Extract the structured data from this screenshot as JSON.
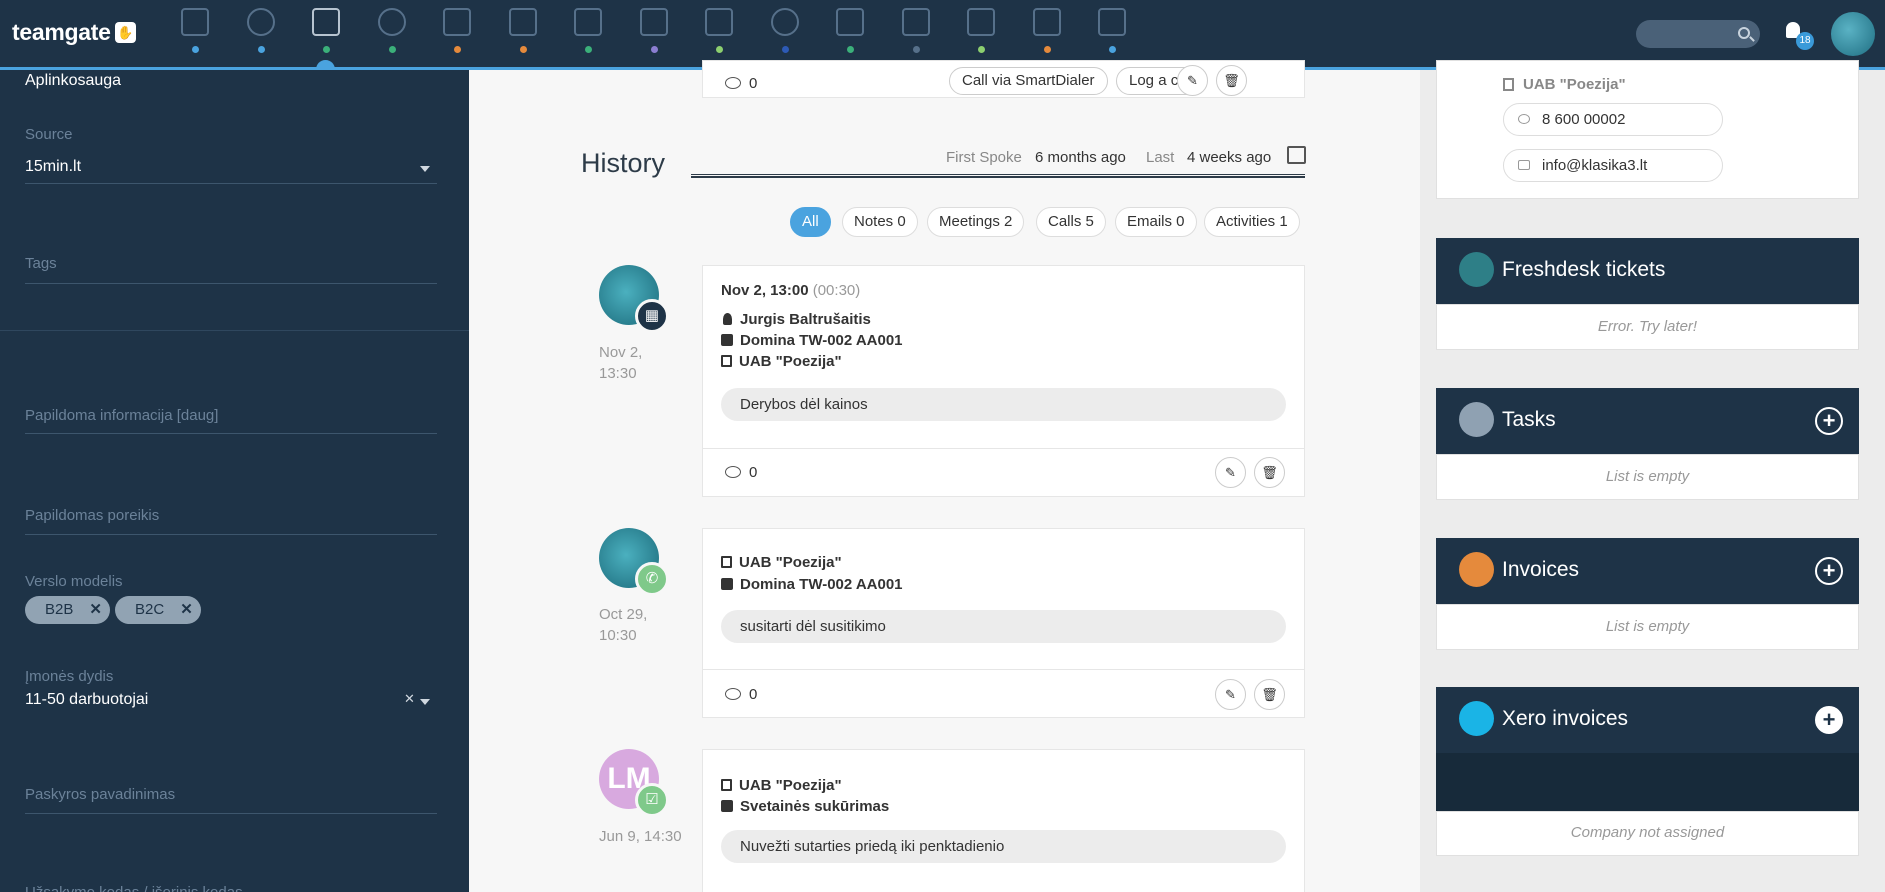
{
  "topbar": {
    "logo": "teamgate",
    "logo_icon": "hand-icon",
    "nav_icons": [
      {
        "name": "dashboard-icon",
        "dot": "#4aa3df"
      },
      {
        "name": "target-icon",
        "dot": "#4aa3df"
      },
      {
        "name": "companies-icon",
        "dot": "#3bb07a"
      },
      {
        "name": "people-icon",
        "dot": "#3bb07a"
      },
      {
        "name": "deals-icon",
        "dot": "#e58a3c"
      },
      {
        "name": "calendar-icon",
        "dot": "#e58a3c"
      },
      {
        "name": "chat-icon",
        "dot": "#3bb07a"
      },
      {
        "name": "download-icon",
        "dot": "#8b7ed1"
      },
      {
        "name": "attachment-icon",
        "dot": "#8ccf6f"
      },
      {
        "name": "pie-chart-icon",
        "dot": "#2d5ab5"
      },
      {
        "name": "messages-icon",
        "dot": "#3bb07a"
      },
      {
        "name": "edit-icon",
        "dot": "#56708a"
      },
      {
        "name": "clip-icon",
        "dot": "#8ccf6f"
      },
      {
        "name": "invoices-icon",
        "dot": "#e58a3c"
      },
      {
        "name": "folder-icon",
        "dot": "#4aa3df"
      }
    ],
    "notifications_count": "18"
  },
  "sidebar": {
    "industry_value": "Aplinkosauga",
    "source_label": "Source",
    "source_value": "15min.lt",
    "tags_label": "Tags",
    "extra_info_label": "Papildoma informacija [daug]",
    "extra_need_label": "Papildomas poreikis",
    "business_model_label": "Verslo modelis",
    "business_model_chips": [
      "B2B",
      "B2C"
    ],
    "company_size_label": "Įmonės dydis",
    "company_size_value": "11-50 darbuotojai",
    "account_name_label": "Paskyros pavadinimas",
    "cutoff_label": "Užsakymo kodas / išorinis kodas"
  },
  "main": {
    "top_card": {
      "comments": "0",
      "call_smartdialer": "Call via SmartDialer",
      "log_call": "Log a call"
    },
    "history": {
      "title": "History",
      "first_spoke_label": "First Spoke",
      "first_spoke_value": "6 months ago",
      "last_label": "Last",
      "last_value": "4 weeks ago",
      "tabs": [
        "All",
        "Notes 0",
        "Meetings 2",
        "Calls 5",
        "Emails 0",
        "Activities 1"
      ]
    },
    "events": [
      {
        "date_line1": "Nov 2,",
        "date_line2": "13:30",
        "header": "Nov 2, 13:00",
        "duration": "(00:30)",
        "person": "Jurgis Baltrušaitis",
        "deal": "Domina TW-002 AA001",
        "company": "UAB \"Poezija\"",
        "note": "Derybos dėl kainos",
        "comments": "0",
        "type": "meeting",
        "type_color": "#1e3347"
      },
      {
        "date_line1": "Oct 29,",
        "date_line2": "10:30",
        "company": "UAB \"Poezija\"",
        "deal": "Domina TW-002 AA001",
        "note": "susitarti dėl susitikimo",
        "comments": "0",
        "type": "call",
        "type_color": "#7fc98a"
      },
      {
        "date_line1": "Jun 9, 14:30",
        "avatar_initials": "LM",
        "company": "UAB \"Poezija\"",
        "deal": "Svetainės sukūrimas",
        "note": "Nuvežti sutarties priedą iki penktadienio",
        "type": "task",
        "type_color": "#7fc98a"
      }
    ]
  },
  "right": {
    "contact": {
      "company": "UAB \"Poezija\"",
      "phone": "8 600 00002",
      "email": "info@klasika3.lt"
    },
    "freshdesk": {
      "title": "Freshdesk tickets",
      "message": "Error. Try later!",
      "icon_color": "#2e7f87"
    },
    "tasks": {
      "title": "Tasks",
      "message": "List is empty",
      "icon_color": "#8fa1b2"
    },
    "invoices": {
      "title": "Invoices",
      "message": "List is empty",
      "icon_color": "#e58a3c"
    },
    "xero": {
      "title": "Xero invoices",
      "message": "Company not assigned",
      "icon_color": "#1ab4e6"
    }
  }
}
